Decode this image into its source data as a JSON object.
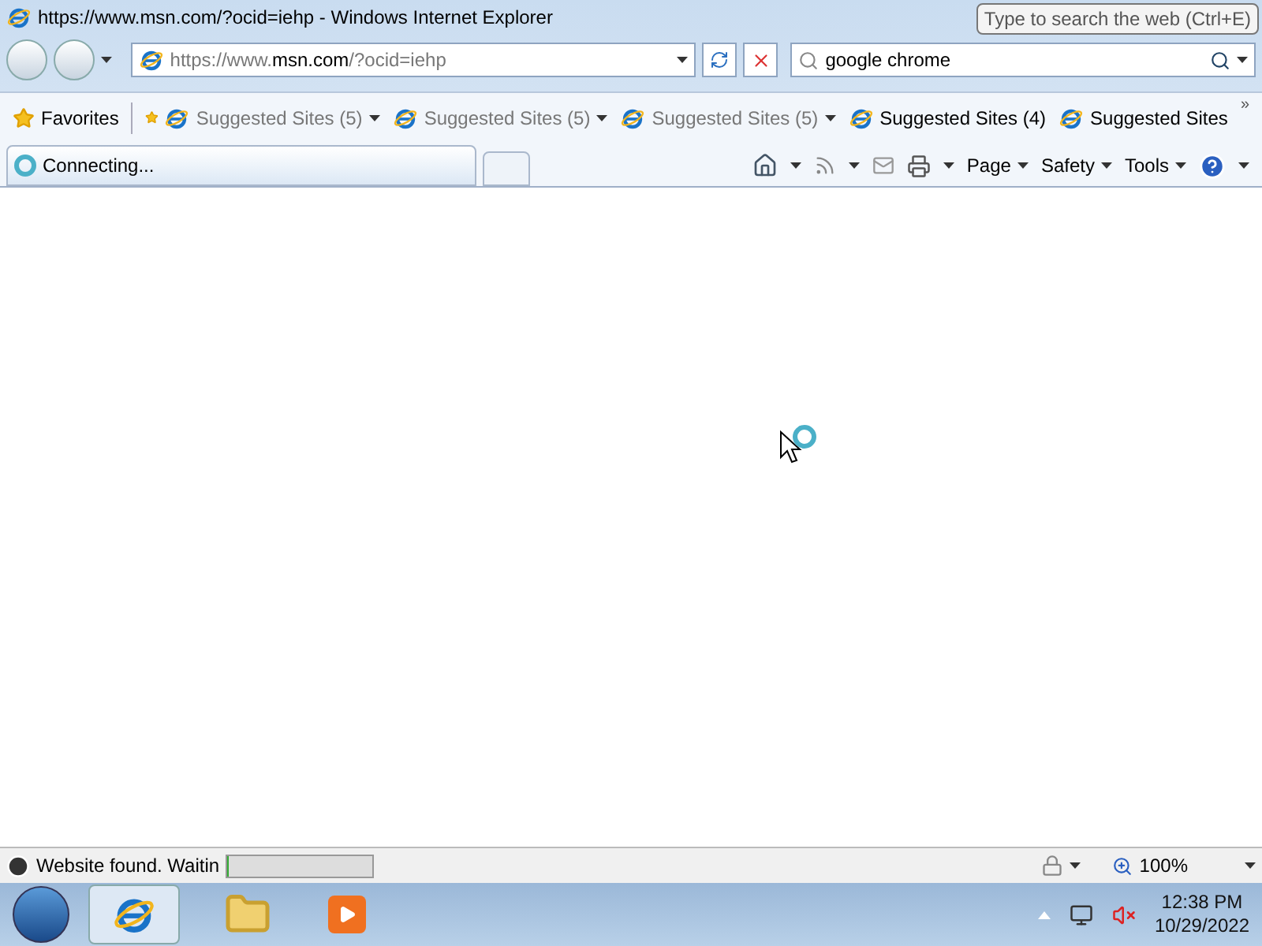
{
  "window": {
    "title": "https://www.msn.com/?ocid=iehp - Windows Internet Explorer"
  },
  "address_bar": {
    "prefix": "https://www.",
    "domain": "msn.com",
    "suffix": "/?ocid=iehp"
  },
  "search": {
    "value": "google chrome",
    "tooltip": "Type to search the web (Ctrl+E)"
  },
  "favorites_bar": {
    "label": "Favorites",
    "items": [
      {
        "label": "Suggested Sites (5)",
        "dimmed": true,
        "dropdown": true
      },
      {
        "label": "Suggested Sites (5)",
        "dimmed": true,
        "dropdown": true
      },
      {
        "label": "Suggested Sites (5)",
        "dimmed": true,
        "dropdown": true
      },
      {
        "label": "Suggested Sites (4)",
        "dimmed": false,
        "dropdown": false
      },
      {
        "label": "Suggested Sites",
        "dimmed": false,
        "dropdown": false
      }
    ],
    "overflow": "»"
  },
  "tabs": [
    {
      "label": "Connecting...",
      "selected": true
    }
  ],
  "command_bar": [
    "Page",
    "Safety",
    "Tools"
  ],
  "status_bar": {
    "text": "Website found. Waitin",
    "level": 0.01,
    "zoom": "100%"
  },
  "taskbar": {
    "time": "12:38 PM",
    "date": "10/29/2022"
  }
}
